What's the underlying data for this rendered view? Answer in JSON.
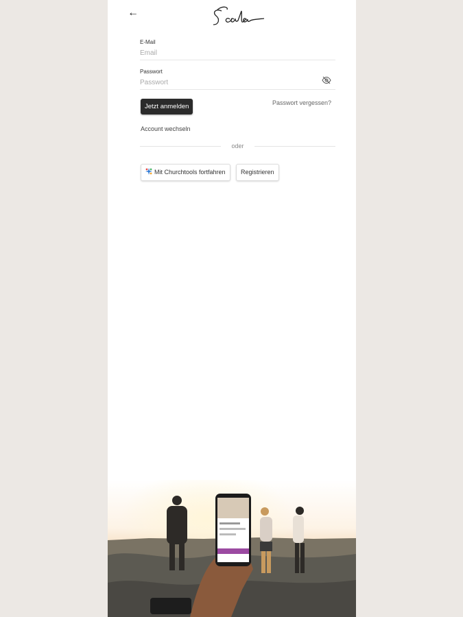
{
  "header": {
    "back_icon": "arrow-left-icon",
    "logo_text": "Scala"
  },
  "form": {
    "email": {
      "label": "E-Mail",
      "placeholder": "Email"
    },
    "password": {
      "label": "Passwort",
      "placeholder": "Passwort",
      "toggle_icon": "eye-off-icon"
    },
    "login_label": "Jetzt anmelden",
    "forgot_label": "Passwort vergessen?",
    "switch_account_label": "Account wechseln",
    "divider_text": "oder",
    "churchtools_label": "Mit Churchtools fortfahren",
    "register_label": "Registrieren"
  },
  "colors": {
    "primary_button": "#2b2b2b",
    "background": "#ece8e4"
  }
}
